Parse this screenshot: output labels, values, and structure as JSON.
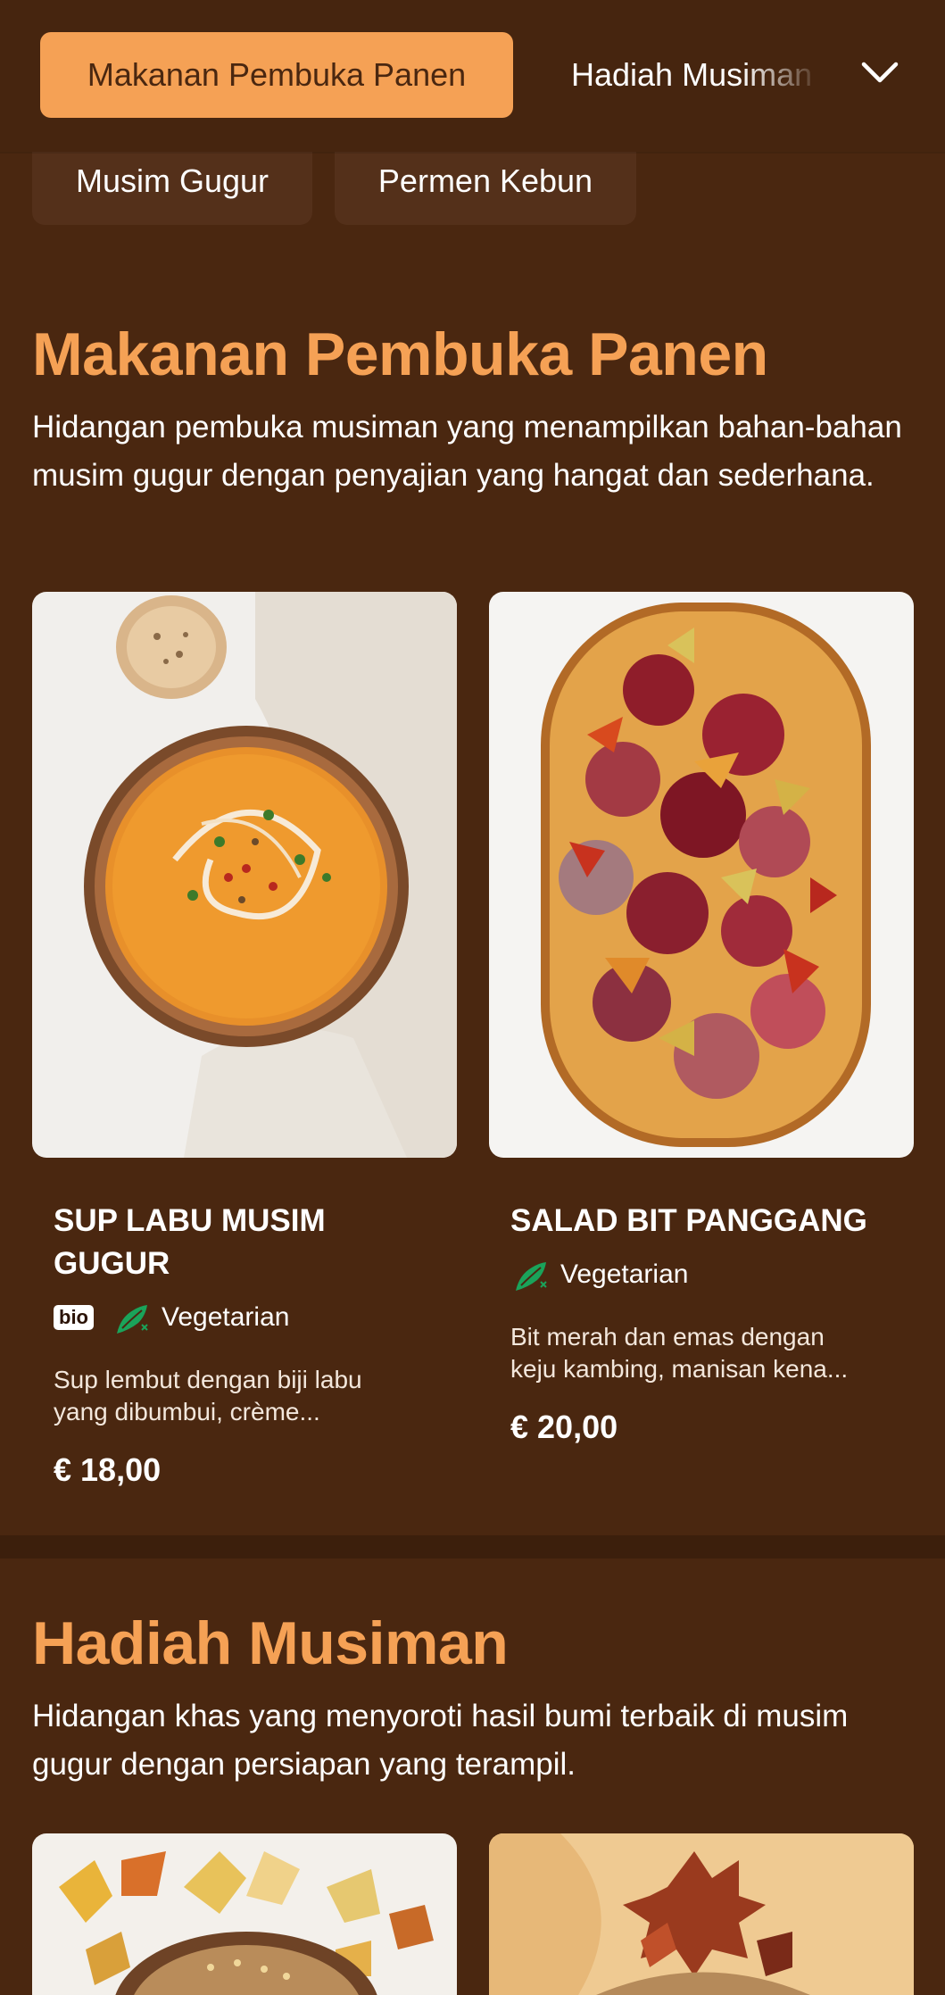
{
  "category_bar": {
    "active": "Makanan Pembuka Panen",
    "next": "Hadiah Musiman",
    "chips": [
      "Musim Gugur",
      "Permen Kebun"
    ]
  },
  "sections": [
    {
      "title": "Makanan Pembuka Panen",
      "description": "Hidangan pembuka musiman yang menampilkan bahan-bahan musim gugur dengan penyajian yang hangat dan sederhana.",
      "items": [
        {
          "name_line1": "SUP LABU MUSIM",
          "name_line2": "GUGUR",
          "badge": "bio",
          "diet": "Vegetarian",
          "desc_line1": "Sup lembut dengan biji labu",
          "desc_line2": "yang dibumbui, crème...",
          "price": "€ 18,00",
          "image_icon": "pumpkin-soup-photo"
        },
        {
          "name_line1": "SALAD BIT PANGGANG",
          "diet": "Vegetarian",
          "desc_line1": "Bit merah dan emas dengan",
          "desc_line2": "keju kambing, manisan kena...",
          "price": "€ 20,00",
          "image_icon": "roasted-beets-photo"
        }
      ]
    },
    {
      "title": "Hadiah Musiman",
      "description": "Hidangan khas yang menyoroti hasil bumi terbaik di musim gugur dengan persiapan yang terampil."
    }
  ],
  "colors": {
    "background": "#4a2710",
    "accent": "#f5a155",
    "veg_green": "#1aa35a"
  },
  "icons": {
    "dropdown": "chevron-down-icon",
    "diet": "vegetarian-leaf-icon"
  }
}
